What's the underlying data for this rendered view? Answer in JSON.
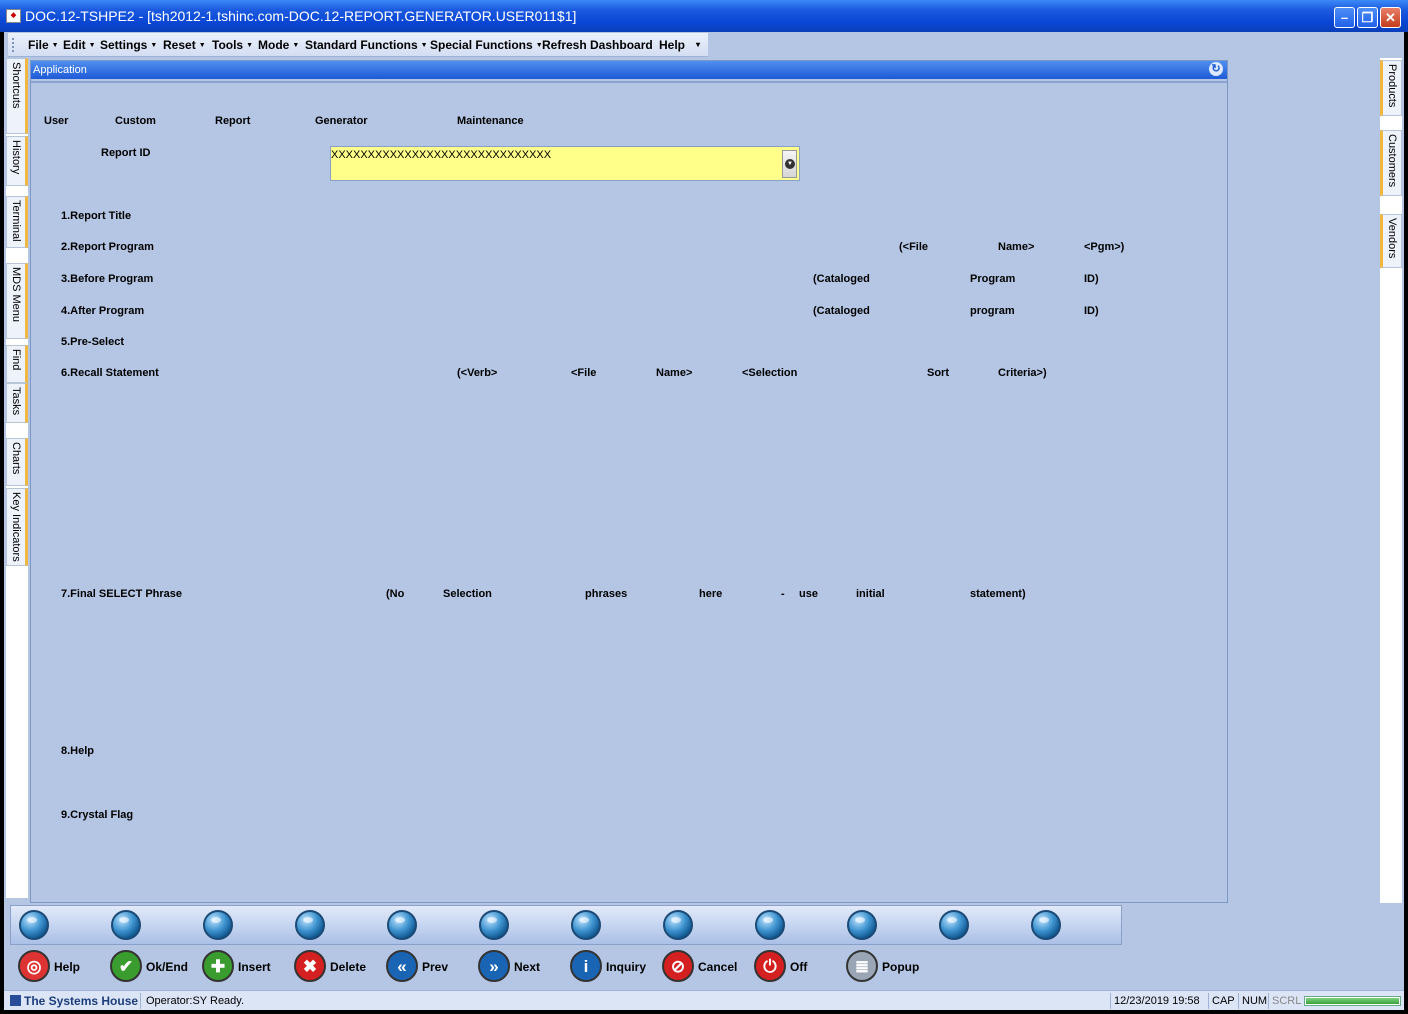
{
  "window": {
    "title": "DOC.12-TSHPE2 - [tsh2012-1.tshinc.com-DOC.12-REPORT.GENERATOR.USER011$1]",
    "minimize_glyph": "–",
    "restore_glyph": "❐",
    "close_glyph": "✕"
  },
  "menu": {
    "items": [
      {
        "label": "File",
        "has_dropdown": true
      },
      {
        "label": "Edit",
        "has_dropdown": true
      },
      {
        "label": "Settings",
        "has_dropdown": true
      },
      {
        "label": "Reset",
        "has_dropdown": true
      },
      {
        "label": "Tools",
        "has_dropdown": true
      },
      {
        "label": "Mode",
        "has_dropdown": true
      },
      {
        "label": "Standard Functions",
        "has_dropdown": true
      },
      {
        "label": "Special Functions",
        "has_dropdown": true
      },
      {
        "label": "Refresh Dashboard",
        "has_dropdown": false
      },
      {
        "label": "Help",
        "has_dropdown": false
      }
    ],
    "overflow_glyph": "▾"
  },
  "left_tabs": [
    "Shortcuts",
    "History",
    "Terminal",
    "MDS Menu",
    "Find",
    "Tasks",
    "Charts",
    "Key Indicators"
  ],
  "right_tabs": [
    "Products",
    "Customers",
    "Vendors"
  ],
  "app_panel": {
    "header": "Application",
    "title_words": [
      "User",
      "Custom",
      "Report",
      "Generator",
      "Maintenance"
    ],
    "report_id_label": "Report ID",
    "report_id_value": "XXXXXXXXXXXXXXXXXXXXXXXXXXXXXX",
    "fields": [
      {
        "label": "1.Report Title",
        "hint": []
      },
      {
        "label": "2.Report Program",
        "hint": [
          "(<File",
          "Name>",
          "<Pgm>)"
        ]
      },
      {
        "label": "3.Before Program",
        "hint": [
          "(Cataloged",
          "Program",
          "ID)"
        ]
      },
      {
        "label": "4.After Program",
        "hint": [
          "(Cataloged",
          "program",
          "ID)"
        ]
      },
      {
        "label": "5.Pre-Select",
        "hint": []
      },
      {
        "label": "6.Recall Statement",
        "hint": [
          "(<Verb>",
          "<File",
          "Name>",
          "<Selection",
          "Sort",
          "Criteria>)"
        ]
      },
      {
        "label": "7.Final SELECT Phrase",
        "hint": [
          "(No",
          "Selection",
          "phrases",
          "here",
          "-",
          "use",
          "initial",
          "statement)"
        ]
      },
      {
        "label": "8.Help",
        "hint": []
      },
      {
        "label": "9.Crystal Flag",
        "hint": []
      }
    ]
  },
  "function_keys_count": 12,
  "actions": [
    {
      "label": "Help",
      "icon": "lifebuoy-icon",
      "color": "#d33"
    },
    {
      "label": "Ok/End",
      "icon": "checkmark-icon",
      "color": "#3a9c2e"
    },
    {
      "label": "Insert",
      "icon": "plus-icon",
      "color": "#3a9c2e"
    },
    {
      "label": "Delete",
      "icon": "x-icon",
      "color": "#d42020"
    },
    {
      "label": "Prev",
      "icon": "rewind-icon",
      "color": "#1a64b4"
    },
    {
      "label": "Next",
      "icon": "fast-forward-icon",
      "color": "#1a64b4"
    },
    {
      "label": "Inquiry",
      "icon": "info-icon",
      "color": "#1a64b4"
    },
    {
      "label": "Cancel",
      "icon": "no-entry-icon",
      "color": "#d42020"
    },
    {
      "label": "Off",
      "icon": "power-icon",
      "color": "#d42020"
    },
    {
      "label": "Popup",
      "icon": "database-add-icon",
      "color": "#9aa6b6"
    }
  ],
  "status": {
    "brand": "The Systems House",
    "message": "Operator:SY Ready.",
    "datetime": "12/23/2019 19:58",
    "caps": "CAP",
    "num": "NUM",
    "scrl": "SCRL",
    "progress_fraction": 1.0
  }
}
